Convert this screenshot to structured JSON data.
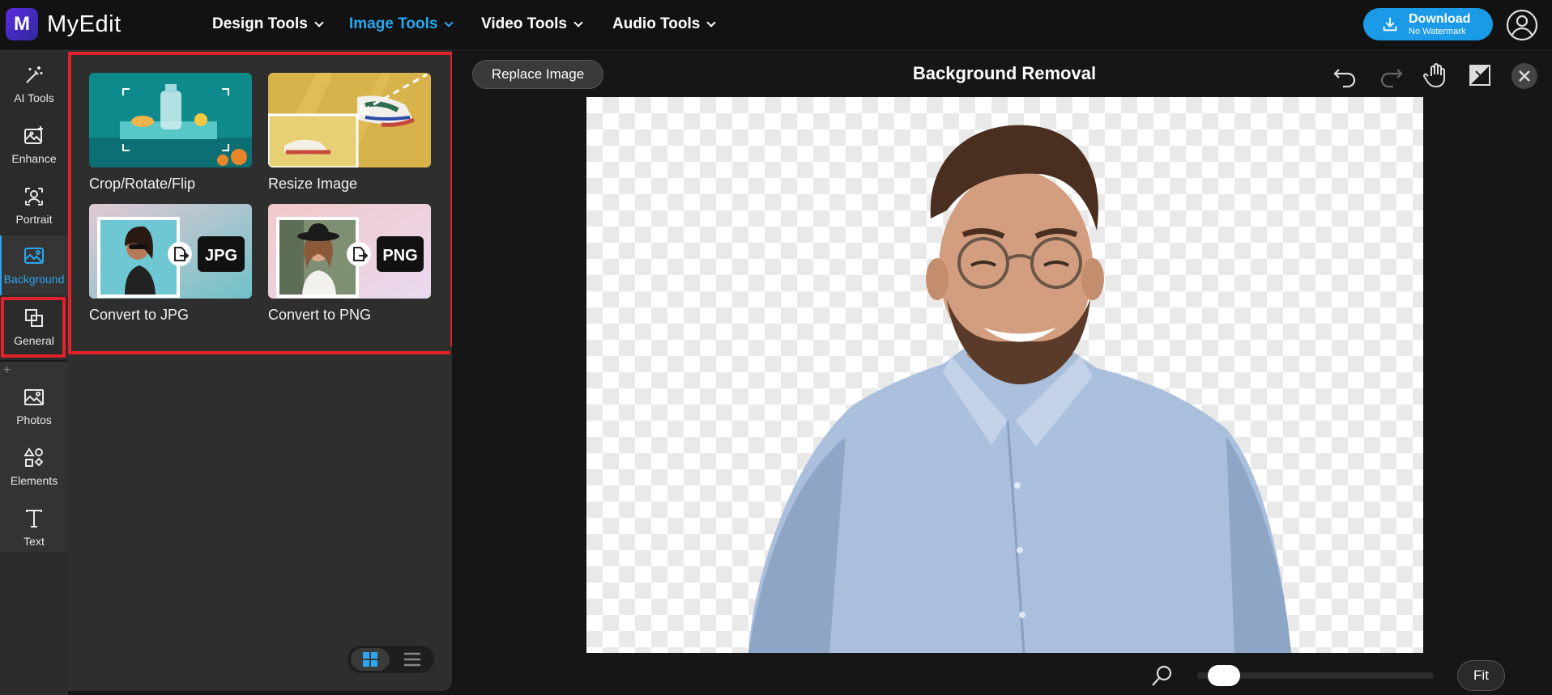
{
  "app": {
    "name": "MyEdit",
    "logo_letter": "M"
  },
  "nav": [
    {
      "label": "Design Tools",
      "active": false
    },
    {
      "label": "Image Tools",
      "active": true
    },
    {
      "label": "Video Tools",
      "active": false
    },
    {
      "label": "Audio Tools",
      "active": false
    }
  ],
  "download": {
    "label": "Download",
    "sublabel": "No Watermark"
  },
  "rail": {
    "items": [
      {
        "label": "AI Tools",
        "icon": "magic-wand-icon"
      },
      {
        "label": "Enhance",
        "icon": "enhance-icon"
      },
      {
        "label": "Portrait",
        "icon": "portrait-icon"
      },
      {
        "label": "Background",
        "icon": "background-icon",
        "active": true
      },
      {
        "label": "General",
        "icon": "general-icon"
      },
      {
        "label": "Photos",
        "icon": "photos-icon"
      },
      {
        "label": "Elements",
        "icon": "elements-icon"
      },
      {
        "label": "Text",
        "icon": "text-icon"
      }
    ],
    "plus": "+"
  },
  "panel": {
    "tools": [
      {
        "label": "Crop/Rotate/Flip"
      },
      {
        "label": "Resize Image"
      },
      {
        "label": "Convert to JPG",
        "badge": "JPG"
      },
      {
        "label": "Convert to PNG",
        "badge": "PNG"
      }
    ]
  },
  "editor": {
    "replace_label": "Replace Image",
    "title": "Background Removal",
    "fit_label": "Fit",
    "zoom_level": 0.05
  },
  "colors": {
    "accent": "#1b9ae8",
    "highlight": "#e0222a"
  }
}
